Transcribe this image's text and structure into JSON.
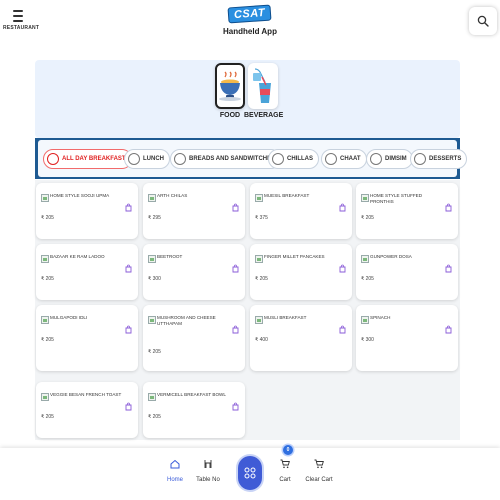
{
  "header": {
    "menu_label": "RESTAURANT",
    "logo_text": "CSAT",
    "app_title": "Handheld App",
    "search_icon": "search-icon"
  },
  "categories": [
    {
      "label": "FOOD",
      "icon": "food-bowl-icon",
      "selected": true
    },
    {
      "label": "BEVERAGE",
      "icon": "beverage-icon",
      "selected": false
    }
  ],
  "subcategories": [
    {
      "label": "ALL DAY BREAKFAST",
      "active": true
    },
    {
      "label": "LUNCH",
      "active": false
    },
    {
      "label": "BREADS AND SANDWITCHES",
      "active": false
    },
    {
      "label": "CHILLAS",
      "active": false
    },
    {
      "label": "CHAAT",
      "active": false
    },
    {
      "label": "DIMSIM",
      "active": false
    },
    {
      "label": "DESSERTS",
      "active": false
    }
  ],
  "products": [
    {
      "name": "HOME STYLE SOOJI UPMA",
      "price": "₹ 205"
    },
    {
      "name": "ARTH CHILAS",
      "price": "₹ 295"
    },
    {
      "name": "MUESIL BREAKFAST",
      "price": "₹ 375"
    },
    {
      "name": "HOME STYLE STUFFED PRONTHIS",
      "price": "₹ 205"
    },
    {
      "name": "BAZAAR KE RAM LADOO",
      "price": "₹ 205"
    },
    {
      "name": "BEETROOT",
      "price": "₹ 300"
    },
    {
      "name": "FINGER MILLET PANCAKES",
      "price": "₹ 205"
    },
    {
      "name": "GUNPOWER DOSA",
      "price": "₹ 205"
    },
    {
      "name": "MULGAPODI IDLI",
      "price": "₹ 205"
    },
    {
      "name": "MUSHROOM AND CHEESE UTTHAPAM",
      "price": "₹ 205"
    },
    {
      "name": "MUSLI BREAKFAST",
      "price": "₹ 400"
    },
    {
      "name": "SPINACH",
      "price": "₹ 300"
    },
    {
      "name": "VEGGIE BESAN FRENCH TOAST",
      "price": "₹ 205"
    },
    {
      "name": "VERMICELL BREAKFAST BOWL",
      "price": "₹ 205"
    }
  ],
  "bottom_nav": {
    "home_label": "Home",
    "table_label": "Table No",
    "cart_label": "Cart",
    "clear_label": "Clear Cart",
    "cart_count": "0"
  },
  "colors": {
    "accent": "#3f5bd6",
    "active_chip": "#e02020",
    "sub_bar": "#1e5a92"
  }
}
